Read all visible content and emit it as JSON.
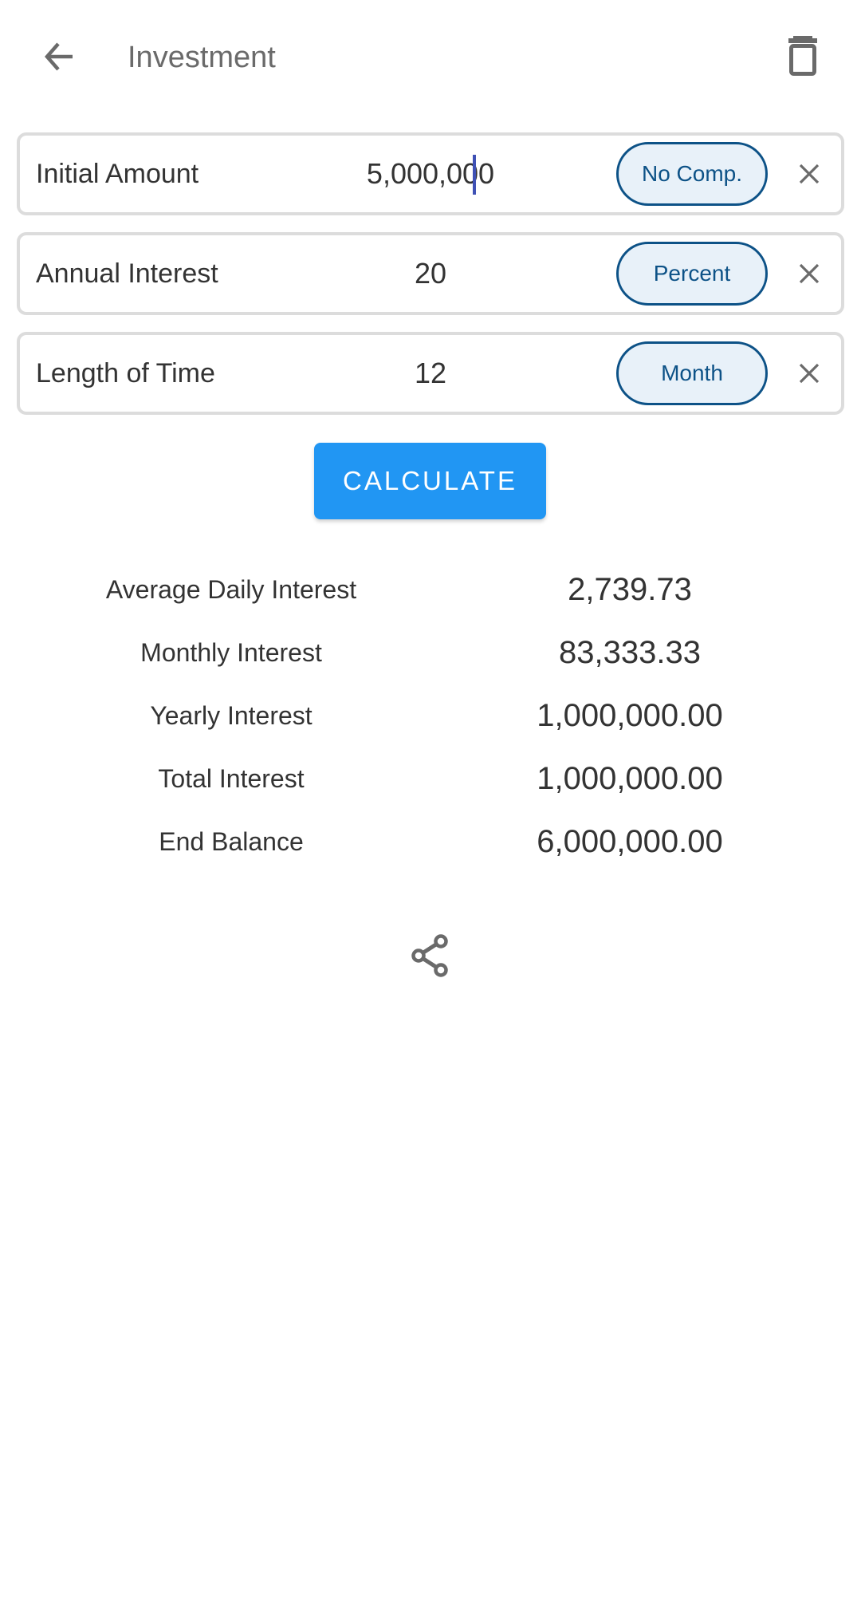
{
  "app_bar": {
    "title": "Investment",
    "back_icon": "arrow-back-icon",
    "delete_icon": "trash-icon"
  },
  "fields": [
    {
      "label": "Initial Amount",
      "value": "5,000,000",
      "unit": "No Comp.",
      "focused": true
    },
    {
      "label": "Annual Interest",
      "value": "20",
      "unit": "Percent",
      "focused": false
    },
    {
      "label": "Length of Time",
      "value": "12",
      "unit": "Month",
      "focused": false
    }
  ],
  "calculate_label": "CALCULATE",
  "results": [
    {
      "label": "Average Daily Interest",
      "value": "2,739.73"
    },
    {
      "label": "Monthly Interest",
      "value": "83,333.33"
    },
    {
      "label": "Yearly Interest",
      "value": "1,000,000.00"
    },
    {
      "label": "Total Interest",
      "value": "1,000,000.00"
    },
    {
      "label": "End Balance",
      "value": "6,000,000.00"
    }
  ],
  "share_icon": "share-icon",
  "colors": {
    "accent": "#2196f3",
    "pill_border": "#0d5287",
    "pill_bg": "#e8f1f9",
    "caret": "#3f51b5",
    "icon_gray": "#6a6a6a"
  }
}
